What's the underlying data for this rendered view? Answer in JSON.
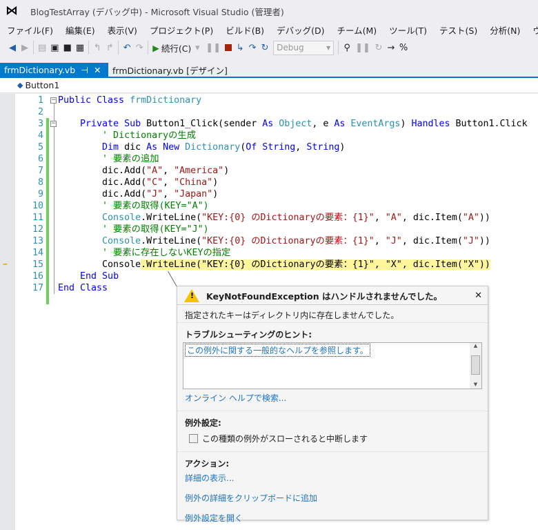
{
  "window": {
    "title": "BlogTestArray (デバッグ中) - Microsoft Visual Studio (管理者)"
  },
  "menu": [
    "ファイル(F)",
    "編集(E)",
    "表示(V)",
    "プロジェクト(P)",
    "ビルド(B)",
    "デバッグ(D)",
    "チーム(M)",
    "ツール(T)",
    "テスト(S)",
    "分析(N)",
    "ウ"
  ],
  "toolbar": {
    "continue_label": "続行(C)",
    "config_value": "Debug"
  },
  "tabs": [
    {
      "label": "frmDictionary.vb",
      "active": true
    },
    {
      "label": "frmDictionary.vb [デザイン]",
      "active": false
    }
  ],
  "navbar": {
    "member": "Button1"
  },
  "code": {
    "current_line": 15,
    "lines": [
      [
        [
          "kw",
          "Public Class "
        ],
        [
          "ty",
          "frmDictionary"
        ]
      ],
      [],
      [
        [
          "pl",
          "    "
        ],
        [
          "kw",
          "Private Sub "
        ],
        [
          "pl",
          "Button1_Click(sender "
        ],
        [
          "kw",
          "As "
        ],
        [
          "ty",
          "Object"
        ],
        [
          "pl",
          ", e "
        ],
        [
          "kw",
          "As "
        ],
        [
          "ty",
          "EventArgs"
        ],
        [
          "pl",
          ") "
        ],
        [
          "kw",
          "Handles "
        ],
        [
          "pl",
          "Button1.Click"
        ]
      ],
      [
        [
          "pl",
          "        "
        ],
        [
          "cm",
          "' Dictionaryの生成"
        ]
      ],
      [
        [
          "pl",
          "        "
        ],
        [
          "kw",
          "Dim "
        ],
        [
          "pl",
          "dic "
        ],
        [
          "kw",
          "As New "
        ],
        [
          "ty",
          "Dictionary"
        ],
        [
          "pl",
          "("
        ],
        [
          "kw",
          "Of String"
        ],
        [
          "pl",
          ", "
        ],
        [
          "kw",
          "String"
        ],
        [
          "pl",
          ")"
        ]
      ],
      [
        [
          "pl",
          "        "
        ],
        [
          "cm",
          "' 要素の追加"
        ]
      ],
      [
        [
          "pl",
          "        dic.Add("
        ],
        [
          "st",
          "\"A\""
        ],
        [
          "pl",
          ", "
        ],
        [
          "st",
          "\"America\""
        ],
        [
          "pl",
          ")"
        ]
      ],
      [
        [
          "pl",
          "        dic.Add("
        ],
        [
          "st",
          "\"C\""
        ],
        [
          "pl",
          ", "
        ],
        [
          "st",
          "\"China\""
        ],
        [
          "pl",
          ")"
        ]
      ],
      [
        [
          "pl",
          "        dic.Add("
        ],
        [
          "st",
          "\"J\""
        ],
        [
          "pl",
          ", "
        ],
        [
          "st",
          "\"Japan\""
        ],
        [
          "pl",
          ")"
        ]
      ],
      [
        [
          "pl",
          "        "
        ],
        [
          "cm",
          "' 要素の取得(KEY=\"A\")"
        ]
      ],
      [
        [
          "pl",
          "        "
        ],
        [
          "ty",
          "Console"
        ],
        [
          "pl",
          ".WriteLine("
        ],
        [
          "st",
          "\"KEY:{0} のDictionaryの要素：{1}\""
        ],
        [
          "pl",
          ", "
        ],
        [
          "st",
          "\"A\""
        ],
        [
          "pl",
          ", dic.Item("
        ],
        [
          "st",
          "\"A\""
        ],
        [
          "pl",
          "))"
        ]
      ],
      [
        [
          "pl",
          "        "
        ],
        [
          "cm",
          "' 要素の取得(KEY=\"J\")"
        ]
      ],
      [
        [
          "pl",
          "        "
        ],
        [
          "ty",
          "Console"
        ],
        [
          "pl",
          ".WriteLine("
        ],
        [
          "st",
          "\"KEY:{0} のDictionaryの要素：{1}\""
        ],
        [
          "pl",
          ", "
        ],
        [
          "st",
          "\"J\""
        ],
        [
          "pl",
          ", dic.Item("
        ],
        [
          "st",
          "\"J\""
        ],
        [
          "pl",
          "))"
        ]
      ],
      [
        [
          "pl",
          "        "
        ],
        [
          "cm",
          "' 要素に存在しないKEYの指定"
        ]
      ],
      [
        [
          "pl",
          "        Console.WriteLine(\"KEY:{0} のDictionaryの要素：{1}\", \"X\", dic.Item(\"X\"))"
        ]
      ],
      [
        [
          "pl",
          "    "
        ],
        [
          "kw",
          "End Sub"
        ]
      ],
      [
        [
          "kw",
          "End Class"
        ]
      ]
    ]
  },
  "exception": {
    "title": "KeyNotFoundException はハンドルされませんでした。",
    "message": "指定されたキーはディレクトリ内に存在しませんでした。",
    "hints_heading": "トラブルシューティングのヒント:",
    "hint_link": "この例外に関する一般的なヘルプを参照します。",
    "online_help": "オンライン ヘルプで検索...",
    "settings_heading": "例外設定:",
    "break_checkbox": {
      "label": "この種類の例外がスローされると中断します",
      "checked": false
    },
    "actions_heading": "アクション:",
    "actions": [
      "詳細の表示...",
      "例外の詳細をクリップボードに追加",
      "例外設定を開く"
    ]
  }
}
